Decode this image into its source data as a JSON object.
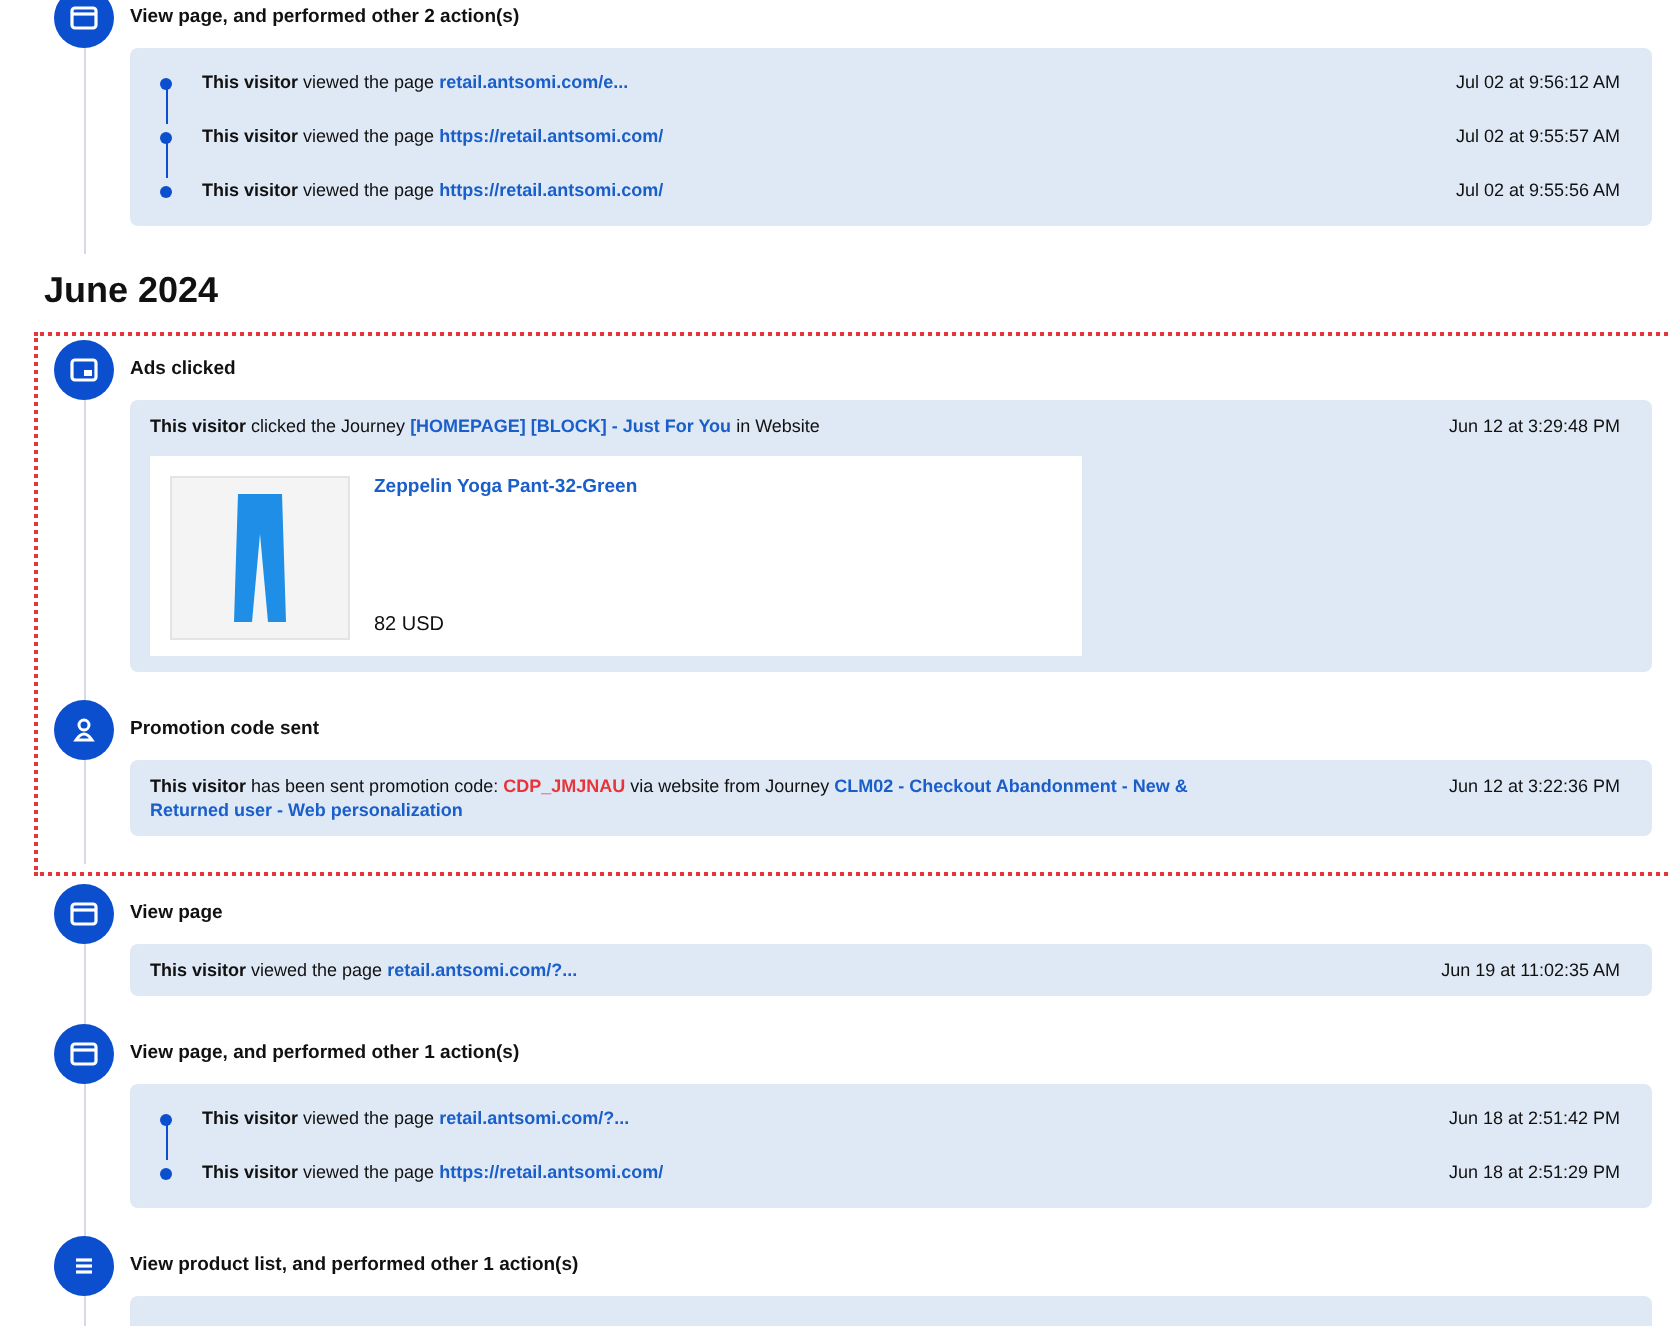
{
  "sections": [
    {
      "blocks": [
        {
          "highlighted": false,
          "events": [
            {
              "kind": "page",
              "title": "View page, and performed other 2 action(s)",
              "entries": [
                {
                  "parts": [
                    {
                      "kind": "bold",
                      "text": "This visitor"
                    },
                    {
                      "kind": "plain",
                      "text": " viewed the page "
                    },
                    {
                      "kind": "link",
                      "text": "retail.antsomi.com/e..."
                    }
                  ],
                  "time": "Jul 02 at 9:56:12 AM"
                },
                {
                  "parts": [
                    {
                      "kind": "bold",
                      "text": "This visitor"
                    },
                    {
                      "kind": "plain",
                      "text": " viewed the page "
                    },
                    {
                      "kind": "link",
                      "text": "https://retail.antsomi.com/"
                    }
                  ],
                  "time": "Jul 02 at 9:55:57 AM"
                },
                {
                  "parts": [
                    {
                      "kind": "bold",
                      "text": "This visitor"
                    },
                    {
                      "kind": "plain",
                      "text": " viewed the page "
                    },
                    {
                      "kind": "link",
                      "text": "https://retail.antsomi.com/"
                    }
                  ],
                  "time": "Jul 02 at 9:55:56 AM"
                }
              ]
            }
          ]
        }
      ]
    },
    {
      "heading": "June 2024",
      "blocks": [
        {
          "highlighted": true,
          "events": [
            {
              "kind": "ad",
              "title": "Ads clicked",
              "entries": [
                {
                  "parts": [
                    {
                      "kind": "bold",
                      "text": "This visitor"
                    },
                    {
                      "kind": "plain",
                      "text": " clicked the Journey "
                    },
                    {
                      "kind": "link",
                      "text": "[HOMEPAGE] [BLOCK] - Just For You"
                    },
                    {
                      "kind": "plain",
                      "text": " in Website"
                    }
                  ],
                  "time": "Jun 12 at 3:29:48 PM",
                  "product": {
                    "name": "Zeppelin Yoga Pant-32-Green",
                    "price": "82 USD"
                  }
                }
              ]
            },
            {
              "kind": "coupon",
              "title": "Promotion code sent",
              "entries": [
                {
                  "parts": [
                    {
                      "kind": "bold",
                      "text": "This visitor"
                    },
                    {
                      "kind": "plain",
                      "text": " has been sent promotion code: "
                    },
                    {
                      "kind": "code",
                      "text": "CDP_JMJNAU"
                    },
                    {
                      "kind": "plain",
                      "text": " via website from Journey "
                    },
                    {
                      "kind": "link",
                      "text": "CLM02 - Checkout Abandonment - New &"
                    },
                    {
                      "kind": "link",
                      "text": "Returned user - Web personalization"
                    }
                  ],
                  "time": "Jun 12 at 3:22:36 PM"
                }
              ]
            }
          ]
        },
        {
          "highlighted": false,
          "events": [
            {
              "kind": "page",
              "title": "View page",
              "entries": [
                {
                  "parts": [
                    {
                      "kind": "bold",
                      "text": "This visitor"
                    },
                    {
                      "kind": "plain",
                      "text": " viewed the page "
                    },
                    {
                      "kind": "link",
                      "text": "retail.antsomi.com/?..."
                    }
                  ],
                  "time": "Jun 19 at 11:02:35 AM"
                }
              ]
            },
            {
              "kind": "page",
              "title": "View page, and performed other 1 action(s)",
              "entries": [
                {
                  "parts": [
                    {
                      "kind": "bold",
                      "text": "This visitor"
                    },
                    {
                      "kind": "plain",
                      "text": " viewed the page "
                    },
                    {
                      "kind": "link",
                      "text": "retail.antsomi.com/?..."
                    }
                  ],
                  "time": "Jun 18 at 2:51:42 PM"
                },
                {
                  "parts": [
                    {
                      "kind": "bold",
                      "text": "This visitor"
                    },
                    {
                      "kind": "plain",
                      "text": " viewed the page "
                    },
                    {
                      "kind": "link",
                      "text": "https://retail.antsomi.com/"
                    }
                  ],
                  "time": "Jun 18 at 2:51:29 PM"
                }
              ]
            },
            {
              "kind": "list",
              "title": "View product list, and performed other 1 action(s)"
            }
          ]
        }
      ]
    }
  ]
}
